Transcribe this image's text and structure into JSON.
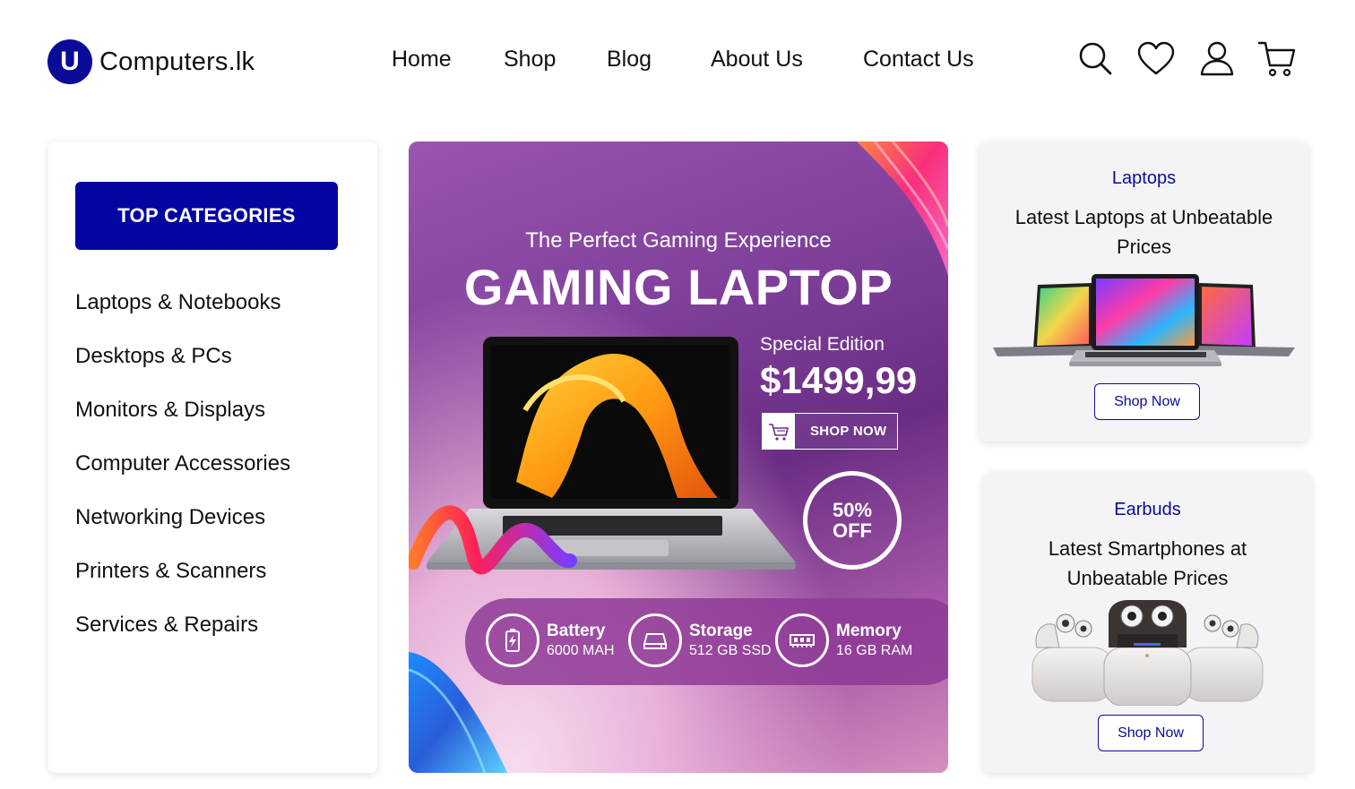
{
  "brand": {
    "logo_letter": "U",
    "name": "Computers.lk",
    "color": "#0b0b9a"
  },
  "nav": {
    "items": [
      {
        "label": "Home"
      },
      {
        "label": "Shop"
      },
      {
        "label": "Blog"
      },
      {
        "label": "About Us"
      },
      {
        "label": "Contact Us"
      }
    ],
    "icons": [
      "search-icon",
      "heart-icon",
      "user-icon",
      "cart-icon"
    ]
  },
  "categories": {
    "title": "TOP CATEGORIES",
    "items": [
      "Laptops & Notebooks",
      "Desktops & PCs",
      "Monitors & Displays",
      "Computer Accessories",
      "Networking Devices",
      "Printers & Scanners",
      "Services & Repairs"
    ]
  },
  "hero": {
    "subtitle": "The Perfect Gaming Experience",
    "title": "GAMING LAPTOP",
    "edition": "Special Edition",
    "price": "$1499,99",
    "shop_label": "SHOP NOW",
    "discount_line1": "50%",
    "discount_line2": "OFF",
    "specs": [
      {
        "name": "Battery",
        "value": "6000 MAH",
        "icon": "battery-charge-icon"
      },
      {
        "name": "Storage",
        "value": "512 GB SSD",
        "icon": "ssd-drive-icon"
      },
      {
        "name": "Memory",
        "value": "16 GB RAM",
        "icon": "ram-chip-icon"
      }
    ]
  },
  "promos": [
    {
      "category": "Laptops",
      "headline": "Latest Laptops at Unbeatable Prices",
      "button": "Shop Now"
    },
    {
      "category": "Earbuds",
      "headline": "Latest Smartphones at Unbeatable Prices",
      "button": "Shop Now"
    }
  ]
}
